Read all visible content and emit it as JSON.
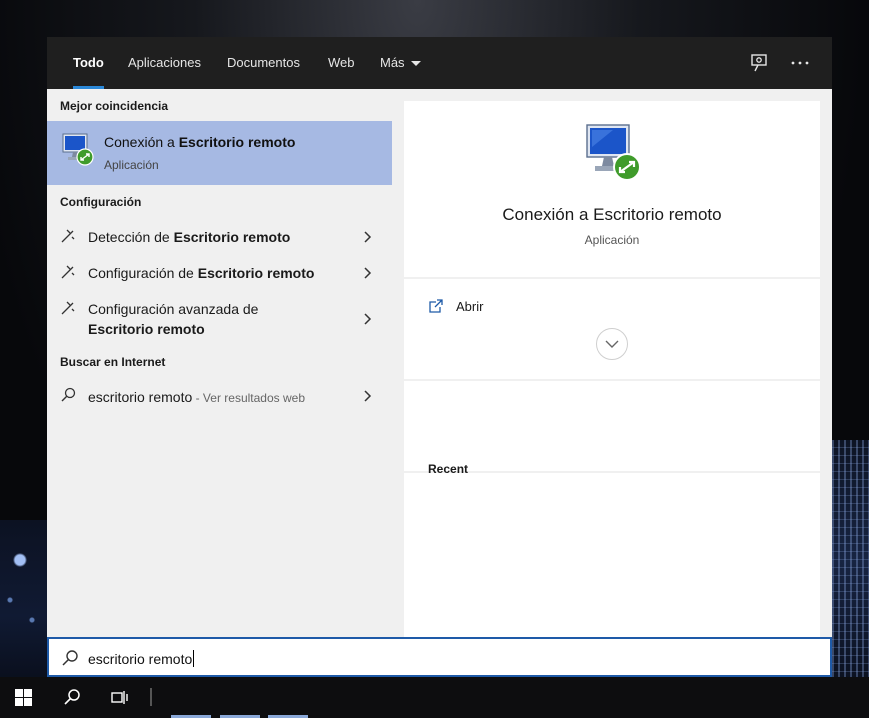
{
  "tabs": [
    {
      "label": "Todo",
      "active": true
    },
    {
      "label": "Aplicaciones"
    },
    {
      "label": "Documentos"
    },
    {
      "label": "Web"
    },
    {
      "label": "Más"
    }
  ],
  "topbar_icons": [
    "feedback-icon",
    "more-options-icon"
  ],
  "results": {
    "best_match_heading": "Mejor coincidencia",
    "best_match": {
      "title_prefix": "Conexión a ",
      "title_bold": "Escritorio remoto",
      "subtitle": "Aplicación",
      "icon": "remote-desktop-icon"
    },
    "settings_heading": "Configuración",
    "settings": [
      {
        "prefix": "Detección de ",
        "bold": "Escritorio remoto",
        "icon": "settings-remote-icon"
      },
      {
        "prefix": "Configuración de ",
        "bold": "Escritorio remoto",
        "icon": "settings-remote-icon"
      },
      {
        "prefix": "Configuración avanzada de",
        "bold": "Escritorio remoto",
        "icon": "settings-remote-icon"
      }
    ],
    "web_heading": "Buscar en Internet",
    "web": {
      "query": "escritorio remoto",
      "hint": " - Ver resultados web",
      "icon": "search-icon"
    }
  },
  "preview": {
    "title": "Conexión a Escritorio remoto",
    "subtitle": "Aplicación",
    "open_label": "Abrir",
    "recent_label": "Recent"
  },
  "search": {
    "value": "escritorio remoto",
    "icon": "search-icon"
  },
  "taskbar": {
    "icons": [
      "windows-start-icon",
      "search-icon",
      "task-view-icon"
    ]
  },
  "colors": {
    "accent": "#2b88d8",
    "selection": "#a6b9e3",
    "topbar": "#1f1f1f",
    "panel": "#f0f0f0",
    "search_border": "#1e5aa8"
  }
}
